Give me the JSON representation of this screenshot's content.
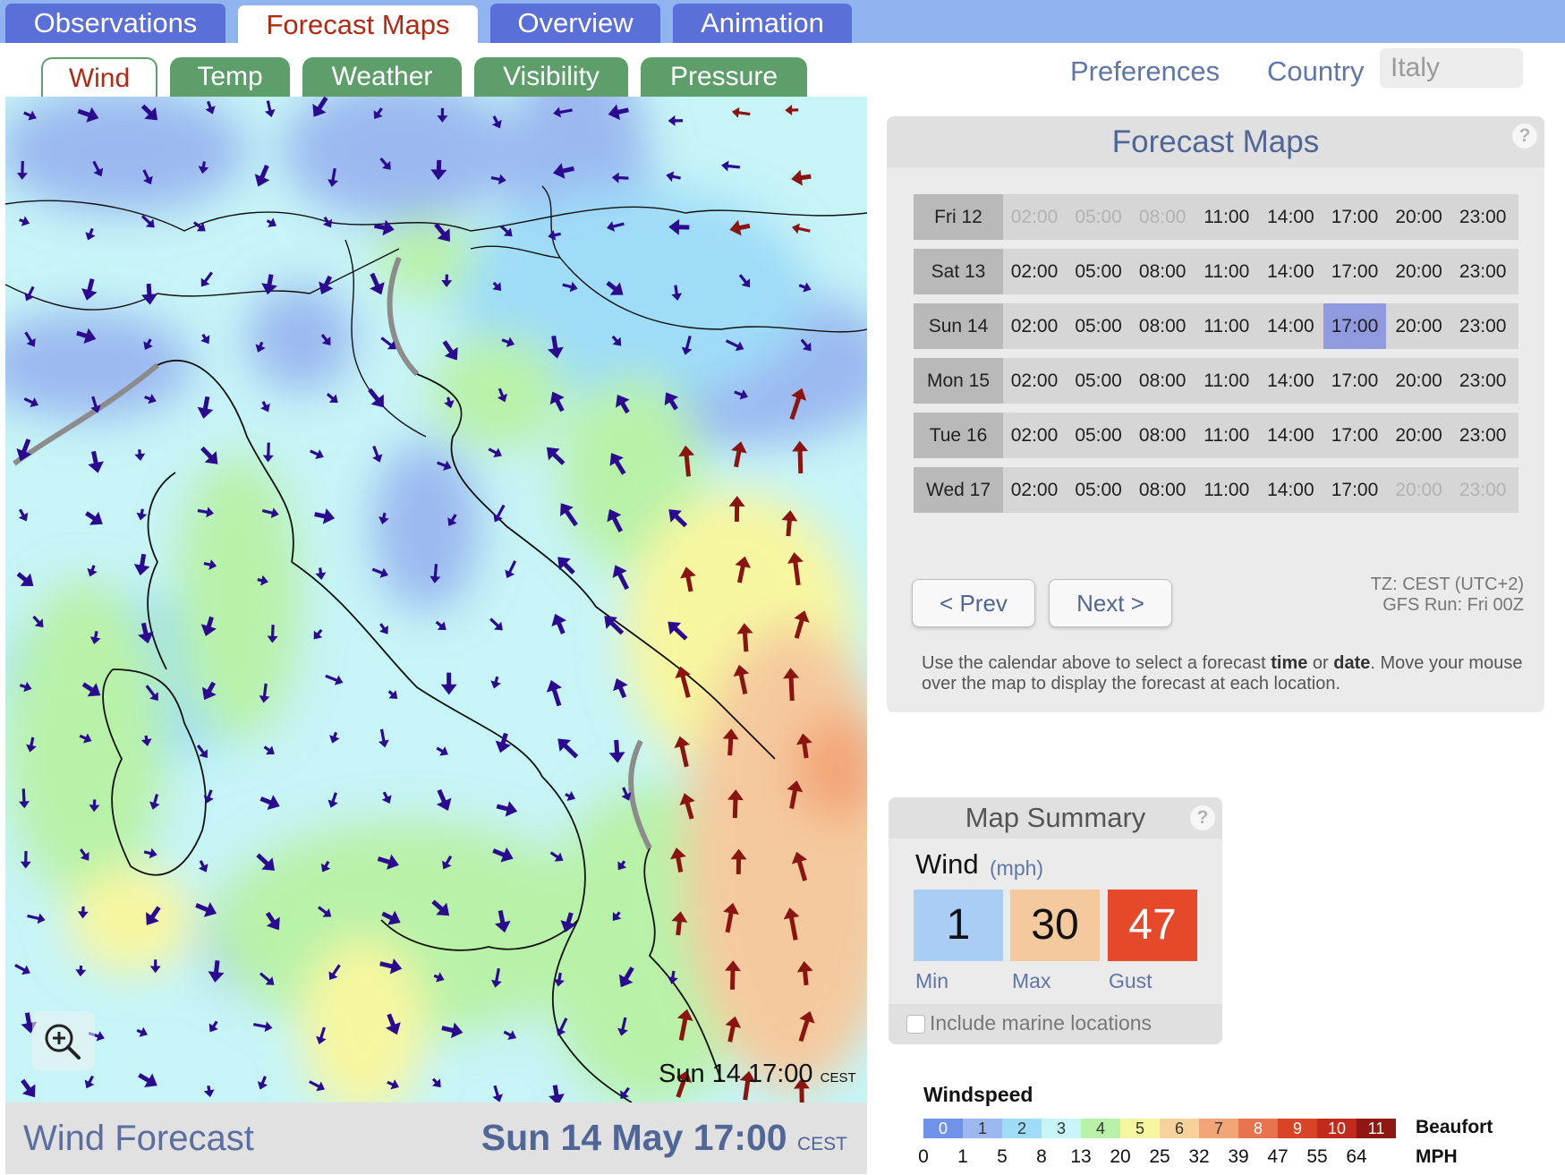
{
  "top_tabs": [
    "Observations",
    "Forecast Maps",
    "Overview",
    "Animation"
  ],
  "sub_tabs": [
    "Wind",
    "Temp",
    "Weather",
    "Visibility",
    "Pressure"
  ],
  "header": {
    "preferences": "Preferences",
    "country_label": "Country",
    "country_value": "Italy"
  },
  "map": {
    "stamp_time": "Sun 14 17:00",
    "stamp_tz": "CEST"
  },
  "footer": {
    "title": "Wind Forecast",
    "datetime": "Sun 14 May 17:00",
    "tz": "CEST"
  },
  "forecast": {
    "title": "Forecast Maps",
    "help": "?",
    "days": [
      {
        "label": "Fri 12",
        "slots": [
          {
            "t": "02:00",
            "state": "dim"
          },
          {
            "t": "05:00",
            "state": "dim"
          },
          {
            "t": "08:00",
            "state": "dim"
          },
          {
            "t": "11:00",
            "state": "normal"
          },
          {
            "t": "14:00",
            "state": "normal"
          },
          {
            "t": "17:00",
            "state": "normal"
          },
          {
            "t": "20:00",
            "state": "normal"
          },
          {
            "t": "23:00",
            "state": "normal"
          }
        ]
      },
      {
        "label": "Sat 13",
        "slots": [
          {
            "t": "02:00",
            "state": "normal"
          },
          {
            "t": "05:00",
            "state": "normal"
          },
          {
            "t": "08:00",
            "state": "normal"
          },
          {
            "t": "11:00",
            "state": "normal"
          },
          {
            "t": "14:00",
            "state": "normal"
          },
          {
            "t": "17:00",
            "state": "normal"
          },
          {
            "t": "20:00",
            "state": "normal"
          },
          {
            "t": "23:00",
            "state": "normal"
          }
        ]
      },
      {
        "label": "Sun 14",
        "slots": [
          {
            "t": "02:00",
            "state": "normal"
          },
          {
            "t": "05:00",
            "state": "normal"
          },
          {
            "t": "08:00",
            "state": "normal"
          },
          {
            "t": "11:00",
            "state": "normal"
          },
          {
            "t": "14:00",
            "state": "normal"
          },
          {
            "t": "17:00",
            "state": "selected"
          },
          {
            "t": "20:00",
            "state": "normal"
          },
          {
            "t": "23:00",
            "state": "normal"
          }
        ]
      },
      {
        "label": "Mon 15",
        "slots": [
          {
            "t": "02:00",
            "state": "normal"
          },
          {
            "t": "05:00",
            "state": "normal"
          },
          {
            "t": "08:00",
            "state": "normal"
          },
          {
            "t": "11:00",
            "state": "normal"
          },
          {
            "t": "14:00",
            "state": "normal"
          },
          {
            "t": "17:00",
            "state": "normal"
          },
          {
            "t": "20:00",
            "state": "normal"
          },
          {
            "t": "23:00",
            "state": "normal"
          }
        ]
      },
      {
        "label": "Tue 16",
        "slots": [
          {
            "t": "02:00",
            "state": "normal"
          },
          {
            "t": "05:00",
            "state": "normal"
          },
          {
            "t": "08:00",
            "state": "normal"
          },
          {
            "t": "11:00",
            "state": "normal"
          },
          {
            "t": "14:00",
            "state": "normal"
          },
          {
            "t": "17:00",
            "state": "normal"
          },
          {
            "t": "20:00",
            "state": "normal"
          },
          {
            "t": "23:00",
            "state": "normal"
          }
        ]
      },
      {
        "label": "Wed 17",
        "slots": [
          {
            "t": "02:00",
            "state": "normal"
          },
          {
            "t": "05:00",
            "state": "normal"
          },
          {
            "t": "08:00",
            "state": "normal"
          },
          {
            "t": "11:00",
            "state": "normal"
          },
          {
            "t": "14:00",
            "state": "normal"
          },
          {
            "t": "17:00",
            "state": "normal"
          },
          {
            "t": "20:00",
            "state": "dim"
          },
          {
            "t": "23:00",
            "state": "dim"
          }
        ]
      }
    ],
    "prev": "< Prev",
    "next": "Next >",
    "tz": "TZ: CEST (UTC+2)",
    "run": "GFS Run: Fri 00Z",
    "instr": {
      "p1": "Use the calendar above to select a forecast ",
      "b1": "time",
      "p2": " or ",
      "b2": "date",
      "p3": ". Move your mouse over the map to display the forecast at each location."
    }
  },
  "summary": {
    "title": "Map Summary",
    "help": "?",
    "variable": "Wind",
    "unit": "(mph)",
    "boxes": [
      {
        "value": "1",
        "label": "Min",
        "color": "#a9cdf5"
      },
      {
        "value": "30",
        "label": "Max",
        "color": "#f5c99e"
      },
      {
        "value": "47",
        "label": "Gust",
        "color": "#e6492a"
      }
    ],
    "marine_label": "Include marine locations"
  },
  "legend": {
    "title": "Windspeed",
    "beaufort_label": "Beaufort",
    "mph_label": "MPH",
    "beaufort": [
      "0",
      "1",
      "2",
      "3",
      "4",
      "5",
      "6",
      "7",
      "8",
      "9",
      "10",
      "11"
    ],
    "colors": [
      "#6f93e8",
      "#9bb9f0",
      "#9fdcf8",
      "#c6f4f7",
      "#b8f2a9",
      "#f7f6a0",
      "#f7d29c",
      "#f2a678",
      "#e8744f",
      "#d94427",
      "#c22a1d",
      "#8f1812"
    ],
    "mph": [
      "0",
      "1",
      "5",
      "8",
      "13",
      "20",
      "25",
      "32",
      "39",
      "47",
      "55",
      "64"
    ]
  }
}
